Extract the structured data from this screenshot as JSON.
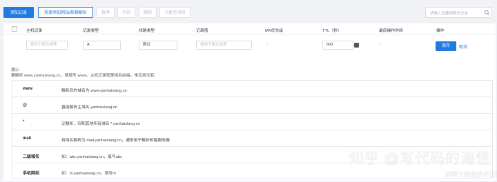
{
  "toolbar": {
    "add_record": "添加记录",
    "quick_add": "快速添加网站/邮箱解析",
    "pause": "暂停",
    "enable": "开启",
    "delete": "删除",
    "assign_group": "分配至项目"
  },
  "search": {
    "placeholder": "请输入您要搜索的记录"
  },
  "table": {
    "columns": [
      "主机记录",
      "记录类型",
      "线路类型",
      "记录值",
      "MX优先级",
      "TTL（秒）",
      "最后操作时间",
      "操作"
    ]
  },
  "edit_row": {
    "host_placeholder": "按向下提示选项",
    "record_type": "A",
    "line_type": "默认",
    "value_placeholder": "按向下提示选项",
    "mx_priority": "-",
    "ttl": "600",
    "last_modified": "-",
    "save": "保存",
    "cancel": "取消"
  },
  "tip": {
    "title": "提示",
    "body": "要解析 www.yanhaixiang.cn，请填写 www。主机记录就是域名前缀，常见用法有：",
    "rows": [
      {
        "key": "www",
        "desc": "解析后的域名为 www.yanhaixiang.cn"
      },
      {
        "key": "@",
        "desc": "直接解析主域名 yanhaixiang.cn"
      },
      {
        "key": "*",
        "desc": "泛解析，匹配其他所有域名 *.yanhaixiang.cn"
      },
      {
        "key": "mail",
        "desc": "将域名解析为 mail.yanhaixiang.cn，通常用于解析邮箱服务器"
      },
      {
        "key": "二级域名",
        "desc": "如：abc.yanhaixiang.cn，填写abc"
      },
      {
        "key": "手机网站",
        "desc": "如：m.yanhaixiang.cn，填写m"
      }
    ]
  },
  "watermark": {
    "main": "知乎 @写代码的海怪",
    "sub": "@稀土掘金技术社区"
  },
  "colors": {
    "primary": "#1f7be0",
    "background": "#f0f2f5",
    "border": "#e6e8eb"
  },
  "icons": {
    "search": "search-icon",
    "stepper": "stepper-icon"
  }
}
